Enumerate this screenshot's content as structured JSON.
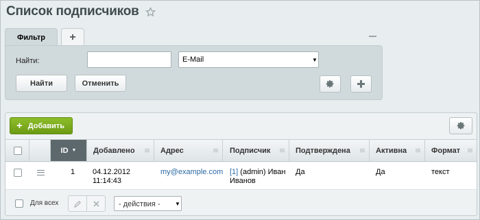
{
  "header": {
    "title": "Список подписчиков",
    "favorite_icon": "star-icon"
  },
  "filter": {
    "tabs": [
      {
        "label": "Фильтр"
      },
      {
        "label": "+"
      }
    ],
    "find_label": "Найти:",
    "find_value": "",
    "field_select": "E-Mail",
    "find_button": "Найти",
    "cancel_button": "Отменить",
    "settings_icon": "gear-icon",
    "add_icon": "plus-icon"
  },
  "list": {
    "add_button": "Добавить",
    "columns": [
      "ID",
      "Добавлено",
      "Адрес",
      "Подписчик",
      "Подтверждена",
      "Активна",
      "Формат"
    ],
    "rows": [
      {
        "id": "1",
        "added_date": "04.12.2012",
        "added_time": "11:14:43",
        "address": "my@example.com",
        "subscriber_id": "[1]",
        "subscriber_name_1": "(admin) Иван",
        "subscriber_name_2": "Иванов",
        "confirmed": "Да",
        "active": "Да",
        "format": "текст"
      }
    ],
    "for_all_label": "Для всех",
    "actions_select": "- действия -"
  },
  "colors": {
    "accent_green": "#7aab1e",
    "link": "#2b68a3",
    "sorted_header": "#5c686c"
  }
}
